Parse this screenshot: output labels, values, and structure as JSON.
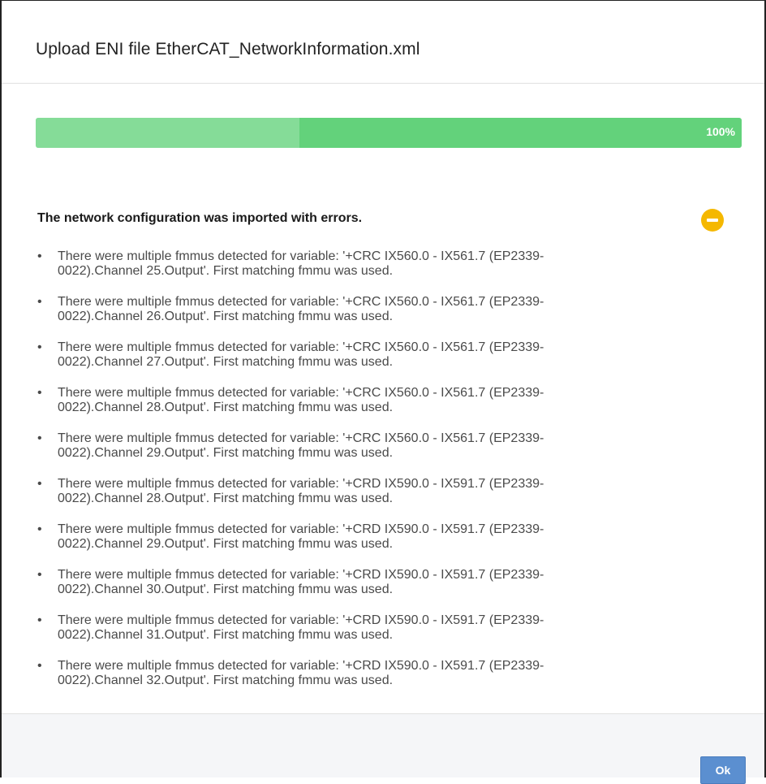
{
  "dialog": {
    "title": "Upload ENI file EtherCAT_NetworkInformation.xml"
  },
  "progress": {
    "value": 100,
    "label": "100%",
    "color": "#63d27b"
  },
  "status": {
    "text": "The network configuration was imported with errors.",
    "icon": "minus-circle-icon",
    "icon_color": "#f5b800"
  },
  "errors": [
    {
      "line1": "There were multiple fmmus detected for variable: '+CRC IX560.0 - IX561.7 (EP2339-",
      "line2": "0022).Channel 25.Output'. First matching fmmu was used."
    },
    {
      "line1": "There were multiple fmmus detected for variable: '+CRC IX560.0 - IX561.7 (EP2339-",
      "line2": "0022).Channel 26.Output'. First matching fmmu was used."
    },
    {
      "line1": "There were multiple fmmus detected for variable: '+CRC IX560.0 - IX561.7 (EP2339-",
      "line2": "0022).Channel 27.Output'. First matching fmmu was used."
    },
    {
      "line1": "There were multiple fmmus detected for variable: '+CRC IX560.0 - IX561.7 (EP2339-",
      "line2": "0022).Channel 28.Output'. First matching fmmu was used."
    },
    {
      "line1": "There were multiple fmmus detected for variable: '+CRC IX560.0 - IX561.7 (EP2339-",
      "line2": "0022).Channel 29.Output'. First matching fmmu was used."
    },
    {
      "line1": "There were multiple fmmus detected for variable: '+CRD IX590.0 - IX591.7 (EP2339-",
      "line2": "0022).Channel 28.Output'. First matching fmmu was used."
    },
    {
      "line1": "There were multiple fmmus detected for variable: '+CRD IX590.0 - IX591.7 (EP2339-",
      "line2": "0022).Channel 29.Output'. First matching fmmu was used."
    },
    {
      "line1": "There were multiple fmmus detected for variable: '+CRD IX590.0 - IX591.7 (EP2339-",
      "line2": "0022).Channel 30.Output'. First matching fmmu was used."
    },
    {
      "line1": "There were multiple fmmus detected for variable: '+CRD IX590.0 - IX591.7 (EP2339-",
      "line2": "0022).Channel 31.Output'. First matching fmmu was used."
    },
    {
      "line1": "There were multiple fmmus detected for variable: '+CRD IX590.0 - IX591.7 (EP2339-",
      "line2": "0022).Channel 32.Output'. First matching fmmu was used."
    }
  ],
  "footer": {
    "ok_label": "Ok",
    "ok_color": "#5b8fd0"
  }
}
